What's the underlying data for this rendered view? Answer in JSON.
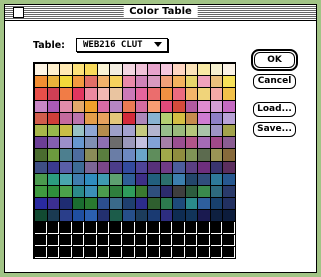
{
  "window": {
    "title": "Color Table"
  },
  "table_label": "Table:",
  "table_popup": {
    "value": "WEB216 CLUT"
  },
  "buttons": {
    "ok": "OK",
    "cancel": "Cancel",
    "load": "Load...",
    "save": "Save..."
  },
  "colors": {
    "background": "#a2c486",
    "rows": [
      [
        "#fff6e6",
        "#fff0cc",
        "#ffe9b3",
        "#fde27a",
        "#f9da5a",
        "#fbf4d4",
        "#f2ede0",
        "#f3d6e1",
        "#f0c0d8",
        "#e7a3cc",
        "#f4c6dd",
        "#ffd6c2",
        "#fbe3b8",
        "#f8e9a5",
        "#f5f0cf",
        "#fbf3e6"
      ],
      [
        "#f28e32",
        "#e9b23b",
        "#f1d93a",
        "#f39a40",
        "#e26f67",
        "#f2b26b",
        "#f5d25d",
        "#e989a9",
        "#cf82b8",
        "#d99ac0",
        "#f0a079",
        "#f3b35f",
        "#e7d56b",
        "#f0a2be",
        "#eac07d",
        "#f7e15a"
      ],
      [
        "#e84f4a",
        "#cf3f55",
        "#f17c46",
        "#e1355f",
        "#ec8aa0",
        "#f2b8b2",
        "#e9c4a0",
        "#cc79b8",
        "#e5659e",
        "#eb6d6d",
        "#f09142",
        "#ec6b80",
        "#f3b56a",
        "#f0d47a",
        "#f4a9a6",
        "#f2c14a"
      ],
      [
        "#c987c6",
        "#aa5ab5",
        "#e18cab",
        "#e4a96c",
        "#f0a02c",
        "#d86ba5",
        "#b685c4",
        "#eb7a54",
        "#d46c9f",
        "#f79d72",
        "#e24a7a",
        "#d64b3c",
        "#b35aa0",
        "#df8bd0",
        "#d49ed5",
        "#c56ac2"
      ],
      [
        "#d15d4c",
        "#cf3f3a",
        "#c46a9d",
        "#bc74ad",
        "#e39d4a",
        "#e6a15e",
        "#e3c77a",
        "#d52a3b",
        "#ad87b8",
        "#88b3d1",
        "#b4cf72",
        "#d4be43",
        "#c68b4e",
        "#cf7bd2",
        "#8f80c7",
        "#b8a2d6"
      ],
      [
        "#a8b64a",
        "#97b84d",
        "#c8bd46",
        "#98c2c5",
        "#8fa6d4",
        "#b58c4e",
        "#9da0c8",
        "#a4a2cf",
        "#c5c97f",
        "#b2b4cf",
        "#97bd8b",
        "#9ab97c",
        "#b5c67b",
        "#a9c4a9",
        "#9e94c4",
        "#a2a24c"
      ],
      [
        "#6c3e96",
        "#845faf",
        "#9b8fca",
        "#6797cf",
        "#7f8fb3",
        "#8d6fb1",
        "#6c6c6c",
        "#9a98bb",
        "#c2bfe0",
        "#82a2d6",
        "#a57fa7",
        "#9a4e90",
        "#b2558a",
        "#a56bb5",
        "#a04989",
        "#8a5c92"
      ],
      [
        "#4a6c2f",
        "#6c9a3e",
        "#4d7f8f",
        "#4d6d9f",
        "#8a8c58",
        "#5a7e3f",
        "#6a7da6",
        "#6d89c1",
        "#6aa4c9",
        "#5f8d5c",
        "#a1a84a",
        "#8f8d3f",
        "#7f9456",
        "#5c6b4f",
        "#9a9456",
        "#876a3b"
      ],
      [
        "#3e4e84",
        "#3b3b8f",
        "#595fa8",
        "#3d6b96",
        "#7b6696",
        "#7a4789",
        "#4b3d8a",
        "#334a9e",
        "#4e4499",
        "#57317a",
        "#703b86",
        "#4c5d9c",
        "#5a3f82",
        "#6e2f7d",
        "#3a356f",
        "#5b2e5e"
      ],
      [
        "#4a9a4e",
        "#2c9d7f",
        "#49a6ad",
        "#3f7dae",
        "#2f8cbf",
        "#3f9ab0",
        "#5da070",
        "#2f5e97",
        "#3d2f87",
        "#225f7d",
        "#2c6f6d",
        "#3c7fae",
        "#23466b",
        "#314e7c",
        "#2e7a9a",
        "#275890"
      ],
      [
        "#3f9a3f",
        "#2f8f3c",
        "#4ba14a",
        "#2b8a8a",
        "#3b8fb6",
        "#4c9c4e",
        "#2f7f3d",
        "#2f9c5c",
        "#3a7a30",
        "#2f4f7d",
        "#2c2c6c",
        "#3e3e3e",
        "#2c5c3e",
        "#3a8a4c",
        "#2e6a7e",
        "#2a3a6a"
      ],
      [
        "#2a2aa0",
        "#3c2f92",
        "#1f2c72",
        "#1b6d30",
        "#297a2f",
        "#2c4f8e",
        "#3a6a8a",
        "#1f3f6f",
        "#2c2c8c",
        "#2f5f2f",
        "#2c7a4e",
        "#1e4a7a",
        "#2a8a8a",
        "#2e5f9e",
        "#18406c",
        "#223060"
      ],
      [
        "#124a32",
        "#1a3a52",
        "#2a3e8a",
        "#1f4ea0",
        "#2b5fb0",
        "#23306f",
        "#1c5c4a",
        "#264f8a",
        "#1c3c5c",
        "#1a3a72",
        "#2d2d80",
        "#0e2c52",
        "#11345a",
        "#1a1a50",
        "#0e2040",
        "#0c1c3c"
      ],
      [
        "#000000",
        "#000000",
        "#000000",
        "#000000",
        "#000000",
        "#000000",
        "#000000",
        "#000000",
        "#000000",
        "#000000",
        "#000000",
        "#000000",
        "#000000",
        "#000000",
        "#000000",
        "#000000"
      ],
      [
        "#000000",
        "#000000",
        "#000000",
        "#000000",
        "#000000",
        "#000000",
        "#000000",
        "#000000",
        "#000000",
        "#000000",
        "#000000",
        "#000000",
        "#000000",
        "#000000",
        "#000000",
        "#000000"
      ],
      [
        "#000000",
        "#000000",
        "#000000",
        "#000000",
        "#000000",
        "#000000",
        "#000000",
        "#000000",
        "#000000",
        "#000000",
        "#000000",
        "#000000",
        "#000000",
        "#000000",
        "#000000",
        "#000000"
      ]
    ]
  }
}
